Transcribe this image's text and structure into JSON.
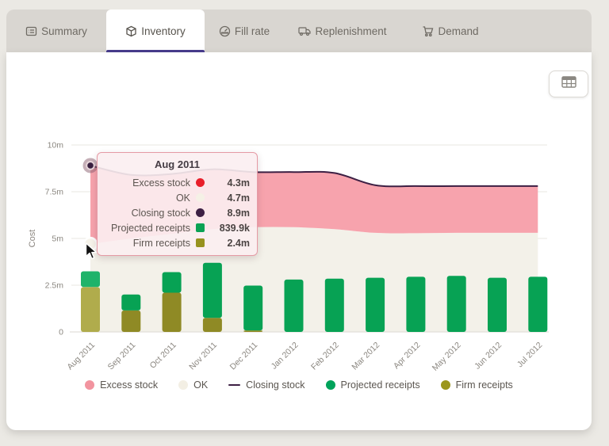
{
  "tabs": [
    {
      "label": "Summary",
      "icon": "summary-icon",
      "active": false
    },
    {
      "label": "Inventory",
      "icon": "inventory-icon",
      "active": true
    },
    {
      "label": "Fill rate",
      "icon": "gauge-icon",
      "active": false
    },
    {
      "label": "Replenishment",
      "icon": "truck-icon",
      "active": false
    },
    {
      "label": "Demand",
      "icon": "cart-icon",
      "active": false
    }
  ],
  "colors": {
    "active_tab_underline": "#453a8c",
    "tab_strip_bg": "#d9d6d1",
    "page_bg": "#ebe9e4"
  },
  "toolbar": {
    "table_button": "table-view"
  },
  "chart_data": {
    "type": "combo",
    "title": "",
    "xlabel": "",
    "ylabel": "Cost",
    "ylim": [
      0,
      10
    ],
    "y_ticks": [
      {
        "label": "10m",
        "value": 10
      },
      {
        "label": "7.5m",
        "value": 7.5
      },
      {
        "label": "5m",
        "value": 5
      },
      {
        "label": "2.5m",
        "value": 2.5
      },
      {
        "label": "0",
        "value": 0
      }
    ],
    "categories": [
      "Aug 2011",
      "Sep 2011",
      "Oct 2011",
      "Nov 2011",
      "Dec 2011",
      "Jan 2012",
      "Feb 2012",
      "Mar 2012",
      "Apr 2012",
      "May 2012",
      "Jun 2012",
      "Jul 2012"
    ],
    "series": [
      {
        "name": "OK",
        "type": "area",
        "color": "#f3f1e9",
        "values": [
          4.7,
          5.0,
          5.25,
          5.5,
          5.6,
          5.6,
          5.5,
          5.3,
          5.28,
          5.3,
          5.3,
          5.3
        ]
      },
      {
        "name": "Excess stock",
        "type": "band",
        "color": "#f7a3ad",
        "upper": "Closing stock",
        "lower": "OK"
      },
      {
        "name": "Closing stock",
        "type": "line",
        "color": "#3d2044",
        "values": [
          8.9,
          8.4,
          8.45,
          8.7,
          8.55,
          8.55,
          8.5,
          7.85,
          7.8,
          7.8,
          7.8,
          7.8
        ]
      },
      {
        "name": "Firm receipts",
        "type": "bar",
        "stack": 0,
        "color": "#8f8a25",
        "highlight_color": "#b0ac4c",
        "values": [
          2.4,
          1.15,
          2.1,
          0.75,
          0.08,
          0,
          0,
          0,
          0,
          0,
          0,
          0
        ]
      },
      {
        "name": "Projected receipts",
        "type": "bar",
        "stack": 1,
        "color": "#07a254",
        "highlight_color": "#1eb36a",
        "values": [
          0.84,
          0.85,
          1.1,
          2.95,
          2.4,
          2.8,
          2.85,
          2.9,
          2.95,
          3.0,
          2.9,
          2.95
        ]
      }
    ],
    "hover": {
      "index": 0,
      "markers": [
        {
          "series": "Closing stock",
          "value": 8.9,
          "color": "#392040"
        },
        {
          "series": "OK",
          "value": 4.7,
          "color": "#f6f3ea"
        }
      ]
    }
  },
  "tooltip": {
    "title": "Aug 2011",
    "rows": [
      {
        "label": "Excess stock",
        "value": "4.3m",
        "color": "#e81f2a",
        "shape": "circle"
      },
      {
        "label": "OK",
        "value": "4.7m",
        "color": "#f5f1e6",
        "shape": "circle"
      },
      {
        "label": "Closing stock",
        "value": "8.9m",
        "color": "#3d2044",
        "shape": "circle"
      },
      {
        "label": "Projected receipts",
        "value": "839.9k",
        "color": "#0aa254",
        "shape": "square"
      },
      {
        "label": "Firm receipts",
        "value": "2.4m",
        "color": "#97921f",
        "shape": "square"
      }
    ]
  },
  "legend": [
    {
      "label": "Excess stock",
      "color": "#f2949f",
      "shape": "circle"
    },
    {
      "label": "OK",
      "color": "#f3efe4",
      "shape": "circle"
    },
    {
      "label": "Closing stock",
      "color": "#3d2044",
      "shape": "line"
    },
    {
      "label": "Projected receipts",
      "color": "#00a35b",
      "shape": "circle"
    },
    {
      "label": "Firm receipts",
      "color": "#9b961d",
      "shape": "circle"
    }
  ]
}
